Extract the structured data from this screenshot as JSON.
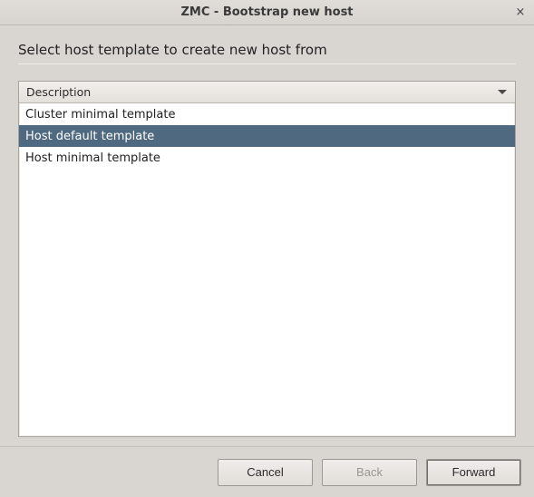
{
  "window": {
    "title": "ZMC - Bootstrap new host"
  },
  "heading": "Select host template to create new host from",
  "list": {
    "column_header": "Description",
    "items": [
      {
        "label": "Cluster minimal template",
        "selected": false
      },
      {
        "label": "Host default template",
        "selected": true
      },
      {
        "label": "Host minimal template",
        "selected": false
      }
    ]
  },
  "buttons": {
    "cancel": "Cancel",
    "back": "Back",
    "forward": "Forward",
    "back_enabled": false
  },
  "colors": {
    "selection_bg": "#4f6a80",
    "window_bg": "#d9d6d2"
  }
}
